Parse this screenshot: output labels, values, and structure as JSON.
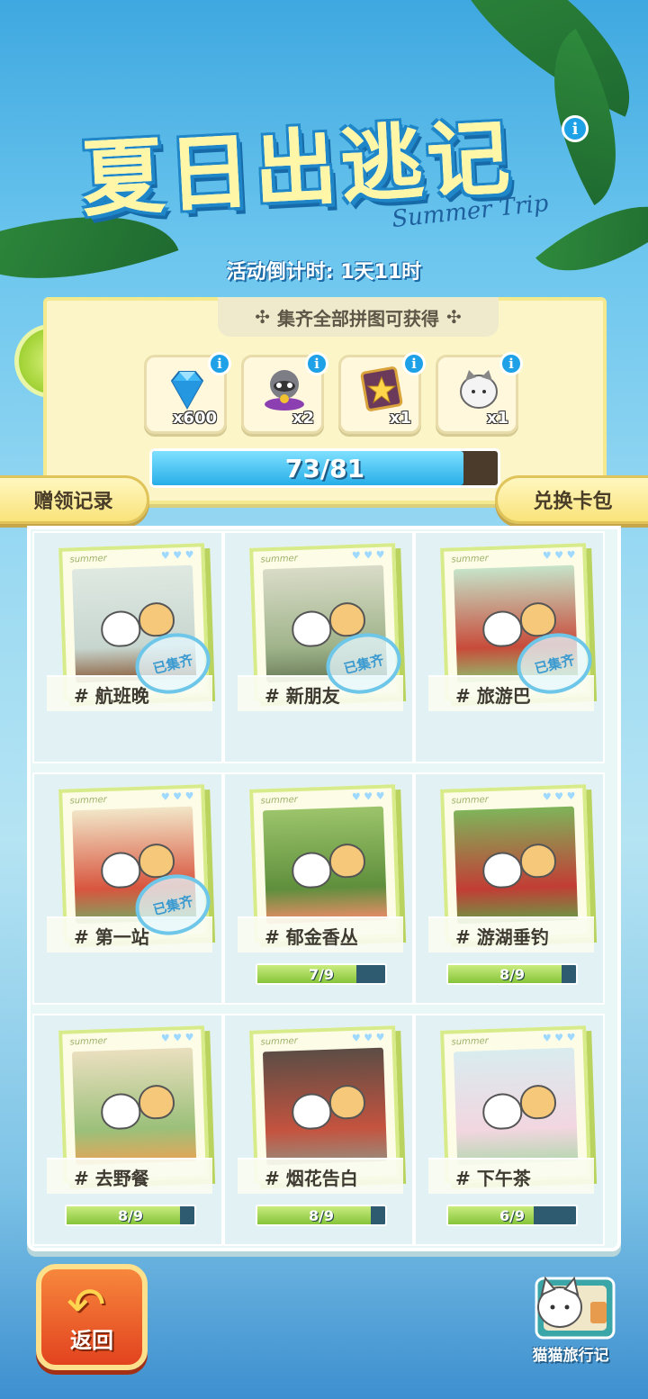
{
  "header": {
    "title": "夏日出逃记",
    "subtitle": "Summer Trip",
    "info": "i",
    "countdown": "活动倒计时: 1天11时"
  },
  "rewards": {
    "banner": "集齐全部拼图可获得",
    "items": [
      {
        "icon": "diamond-icon",
        "qty": "x600",
        "info": "i"
      },
      {
        "icon": "raccoon-figure-icon",
        "qty": "x2",
        "info": "i"
      },
      {
        "icon": "star-card-icon",
        "qty": "x1",
        "info": "i"
      },
      {
        "icon": "cat-pillow-icon",
        "qty": "x1",
        "info": "i"
      }
    ],
    "progress": {
      "text": "73/81",
      "value": 73,
      "max": 81
    }
  },
  "buttons": {
    "gift_record": "赠领记录",
    "exchange": "兑换卡包",
    "back": "返回",
    "journal": "猫猫旅行记"
  },
  "cards": [
    {
      "label": "# 航班晚",
      "stamp": "已集齐",
      "collected": true
    },
    {
      "label": "# 新朋友",
      "stamp": "已集齐",
      "collected": true
    },
    {
      "label": "# 旅游巴",
      "stamp": "已集齐",
      "collected": true
    },
    {
      "label": "# 第一站",
      "stamp": "已集齐",
      "collected": true
    },
    {
      "label": "# 郁金香丛",
      "progress_text": "7/9",
      "progress": 7,
      "max": 9
    },
    {
      "label": "# 游湖垂钓",
      "progress_text": "8/9",
      "progress": 8,
      "max": 9
    },
    {
      "label": "# 去野餐",
      "progress_text": "8/9",
      "progress": 8,
      "max": 9
    },
    {
      "label": "# 烟花告白",
      "progress_text": "8/9",
      "progress": 8,
      "max": 9
    },
    {
      "label": "# 下午茶",
      "progress_text": "6/9",
      "progress": 6,
      "max": 9
    }
  ],
  "card_tag": "summer",
  "card_hearts": "♥ ♥ ♥"
}
